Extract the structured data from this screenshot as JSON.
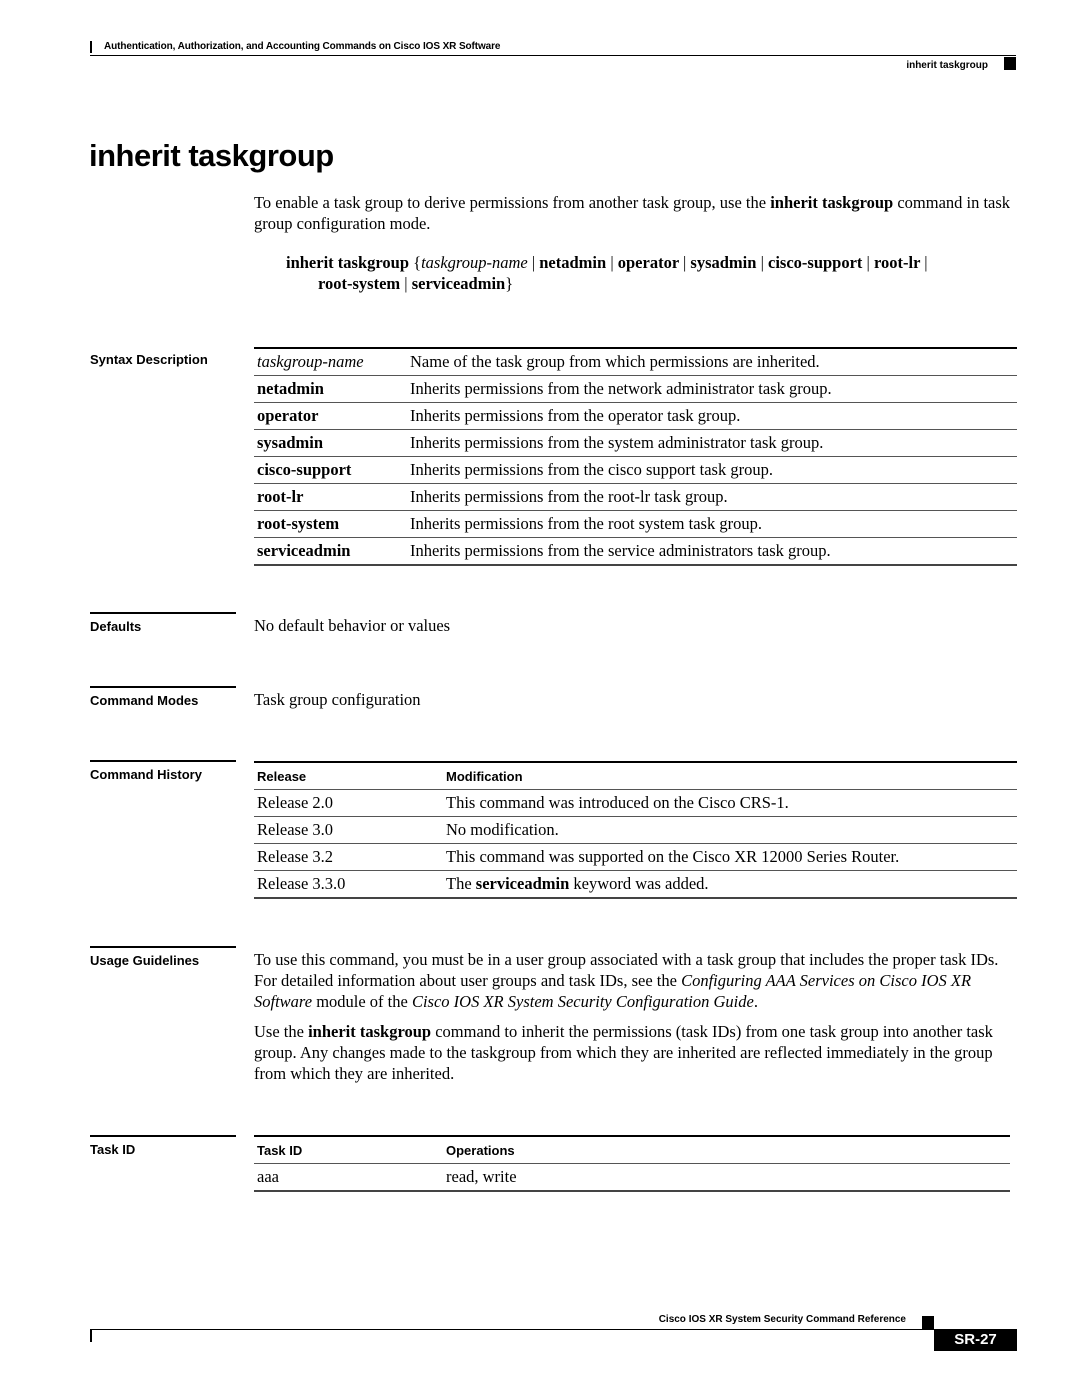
{
  "header": {
    "chapter_title": "Authentication, Authorization, and Accounting Commands on Cisco IOS XR Software",
    "running_head": "inherit taskgroup"
  },
  "page_title": "inherit taskgroup",
  "intro": {
    "text_before": "To enable a task group to derive permissions from another task group, use the ",
    "bold": "inherit taskgroup",
    "text_after": " command in task group configuration mode."
  },
  "syntax": {
    "command": "inherit taskgroup",
    "open_brace": " {",
    "arg": "taskgroup-name",
    "keywords_line1": [
      "netadmin",
      "operator",
      "sysadmin",
      "cisco-support",
      "root-lr"
    ],
    "keywords_line2": [
      "root-system",
      "serviceadmin"
    ],
    "close_brace": "}"
  },
  "sections": {
    "syntax_description": "Syntax Description",
    "defaults": "Defaults",
    "command_modes": "Command Modes",
    "command_history": "Command History",
    "usage_guidelines": "Usage Guidelines",
    "task_id": "Task ID"
  },
  "syntax_table": [
    {
      "term": "taskgroup-name",
      "style": "italic",
      "desc": "Name of the task group from which permissions are inherited."
    },
    {
      "term": "netadmin",
      "style": "bold",
      "desc": "Inherits permissions from the network administrator task group."
    },
    {
      "term": "operator",
      "style": "bold",
      "desc": "Inherits permissions from the operator task group."
    },
    {
      "term": "sysadmin",
      "style": "bold",
      "desc": "Inherits permissions from the system administrator task group."
    },
    {
      "term": "cisco-support",
      "style": "bold",
      "desc": "Inherits permissions from the cisco support task group."
    },
    {
      "term": "root-lr",
      "style": "bold",
      "desc": "Inherits permissions from the root-lr task group."
    },
    {
      "term": "root-system",
      "style": "bold",
      "desc": "Inherits permissions from the root system task group."
    },
    {
      "term": "serviceadmin",
      "style": "bold",
      "desc": "Inherits permissions from the service administrators task group."
    }
  ],
  "defaults_text": "No default behavior or values",
  "command_modes_text": "Task group configuration",
  "history": {
    "headers": [
      "Release",
      "Modification"
    ],
    "rows": [
      {
        "release": "Release 2.0",
        "mod": "This command was introduced on the Cisco CRS-1."
      },
      {
        "release": "Release 3.0",
        "mod": "No modification."
      },
      {
        "release": "Release 3.2",
        "mod": "This command was supported on the Cisco XR 12000 Series Router."
      },
      {
        "release": "Release 3.3.0",
        "mod_before": "The ",
        "mod_bold": "serviceadmin",
        "mod_after": " keyword was added."
      }
    ]
  },
  "usage": {
    "p1_a": "To use this command, you must be in a user group associated with a task group that includes the proper task IDs. For detailed information about user groups and task IDs, see the ",
    "p1_i1": "Configuring AAA Services on Cisco IOS XR Software",
    "p1_b": " module of the ",
    "p1_i2": "Cisco IOS XR System Security Configuration Guide",
    "p1_c": ".",
    "p2_a": "Use the ",
    "p2_bold": "inherit taskgroup",
    "p2_b": " command to inherit the permissions (task IDs) from one task group into another task group. Any changes made to the taskgroup from which they are inherited are reflected immediately in the group from which they are inherited."
  },
  "task_table": {
    "headers": [
      "Task ID",
      "Operations"
    ],
    "rows": [
      {
        "task": "aaa",
        "ops": "read, write"
      }
    ]
  },
  "footer": {
    "book_title": "Cisco IOS XR System Security Command Reference",
    "page_number": "SR-27"
  }
}
